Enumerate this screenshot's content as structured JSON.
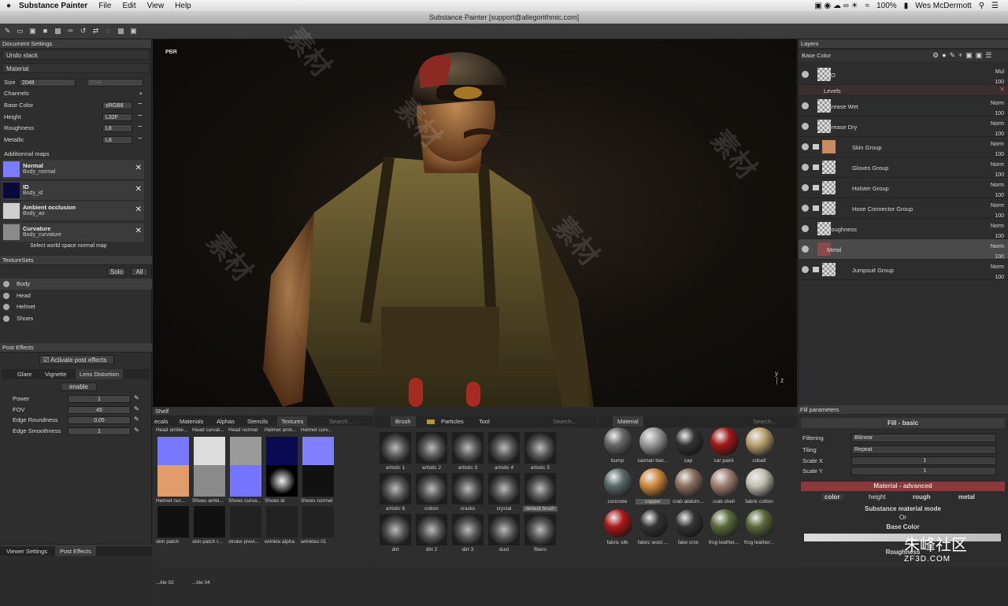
{
  "menubar": {
    "app": "Substance Painter",
    "items": [
      "File",
      "Edit",
      "View",
      "Help"
    ],
    "battery": "100%",
    "user": "Wes McDermott"
  },
  "window_title": "Substance Painter [support@allegorithmic.com]",
  "doc_settings": {
    "title": "Document Settings",
    "undo": "Undo stack",
    "material": "Material",
    "size_label": "Size",
    "size_value": "2048",
    "size_value2": "2048",
    "channels": "Channels",
    "channel_rows": [
      {
        "label": "Base Color",
        "format": "sRGB8"
      },
      {
        "label": "Height",
        "format": "L32F"
      },
      {
        "label": "Roughness",
        "format": "L8"
      },
      {
        "label": "Metallic",
        "format": "L8"
      }
    ],
    "additional": "Additionnal maps",
    "maps": [
      {
        "name": "Normal",
        "file": "Body_normal",
        "color": "#7b7bff"
      },
      {
        "name": "ID",
        "file": "Body_id",
        "color": "#0a0a3a"
      },
      {
        "name": "Ambient occlusion",
        "file": "Body_ao",
        "color": "#cfcfcf"
      },
      {
        "name": "Curvature",
        "file": "Body_curvature",
        "color": "#8a8a8a"
      }
    ],
    "select_ws": "Select world space normal map"
  },
  "texturesets": {
    "title": "TextureSets",
    "solo": "Solo",
    "all": "All",
    "items": [
      "Body",
      "Head",
      "Helmet",
      "Shoes"
    ]
  },
  "post_effects": {
    "title": "Post Effects",
    "activate": "Activate post effects",
    "tabs": [
      "Glare",
      "Vignette",
      "Lens Distortion"
    ],
    "enable": "enable",
    "params": [
      {
        "label": "Power",
        "value": "1"
      },
      {
        "label": "FOV",
        "value": "45"
      },
      {
        "label": "Edge Roundness",
        "value": "0.05"
      },
      {
        "label": "Edge Smoothness",
        "value": "1"
      }
    ],
    "bottom_tabs": [
      "Viewer Settings",
      "Post Effects"
    ]
  },
  "viewport": {
    "mode": "PBR",
    "axis_x": "z",
    "axis_y": "y"
  },
  "layers": {
    "title": "Layers",
    "channel": "Base Color",
    "items": [
      {
        "name": "AO",
        "blend": "Mul",
        "opacity": "100"
      },
      {
        "name": "Levels",
        "blend": "",
        "opacity": ""
      },
      {
        "name": "Grease Wet",
        "blend": "Norm",
        "opacity": "100"
      },
      {
        "name": "Grease Dry",
        "blend": "Norm",
        "opacity": "100"
      },
      {
        "name": "Skin Group",
        "blend": "Norm",
        "opacity": "100"
      },
      {
        "name": "Gloves Group",
        "blend": "Norm",
        "opacity": "100"
      },
      {
        "name": "Holster Group",
        "blend": "Norm",
        "opacity": "100"
      },
      {
        "name": "Hose Connector Group",
        "blend": "Norm",
        "opacity": "100"
      },
      {
        "name": "Roughness",
        "blend": "Norm",
        "opacity": "100"
      },
      {
        "name": "Metal",
        "blend": "Norm",
        "opacity": "100"
      },
      {
        "name": "Jumpsuit Group",
        "blend": "Norm",
        "opacity": "100"
      }
    ]
  },
  "shelf": {
    "title": "Shelf",
    "tabs": [
      "ecals",
      "Materials",
      "Alphas",
      "Stencils",
      "Textures"
    ],
    "search": "Search...",
    "row1": [
      "Head ambie...",
      "Head curvat...",
      "Head normal",
      "Helmet amb...",
      "Helmet curv..."
    ],
    "row2": [
      "Helmet nor...",
      "Shoes ambi...",
      "Shoes curva...",
      "Shoes id",
      "Shoes normal"
    ],
    "row3": [
      "skin patch",
      "skin patch r...",
      "stroke previ...",
      "wrinkle alpha",
      "wrinkles 01"
    ],
    "row4": [
      "...kle 02",
      "...kle 04"
    ]
  },
  "brush": {
    "tabs": [
      "Brush",
      "Particles",
      "Tool"
    ],
    "search": "Search...",
    "items": [
      "artistic 1",
      "artistic 2",
      "artistic 3",
      "artistic 4",
      "artistic 5",
      "artistic 6",
      "cotton",
      "cracks",
      "crystal",
      "default brush",
      "dirt",
      "dirt 2",
      "dirt 3",
      "dust",
      "fibers"
    ]
  },
  "material": {
    "title": "Material",
    "search": "Search...",
    "row1": [
      "bump",
      "caiman bac...",
      "cap",
      "car paint",
      "cobalt"
    ],
    "row2": [
      "concrete",
      "copper",
      "crab abdom...",
      "crab shell",
      "fabric cotton"
    ],
    "row3": [
      "fabric silk",
      "fabric wool ...",
      "fake croc",
      "frog leather...",
      "frog leather..."
    ]
  },
  "fill": {
    "title": "Fill parameters",
    "basic": "Fill - basic",
    "rows": [
      {
        "label": "Filtering",
        "value": "Bilinear"
      },
      {
        "label": "Tiling",
        "value": "Repeat"
      }
    ],
    "scales": [
      {
        "label": "Scale X",
        "value": "1"
      },
      {
        "label": "Scale Y",
        "value": "1"
      }
    ],
    "advanced": "Material - advanced",
    "channels": [
      "color",
      "height",
      "rough",
      "metal"
    ],
    "mode": "Substance material mode",
    "or": "Or",
    "base_color": "Base Color",
    "roughness": "Roughness"
  },
  "watermark": {
    "text": "素材",
    "site": "朱峰社区",
    "url": "ZF3D.COM"
  }
}
